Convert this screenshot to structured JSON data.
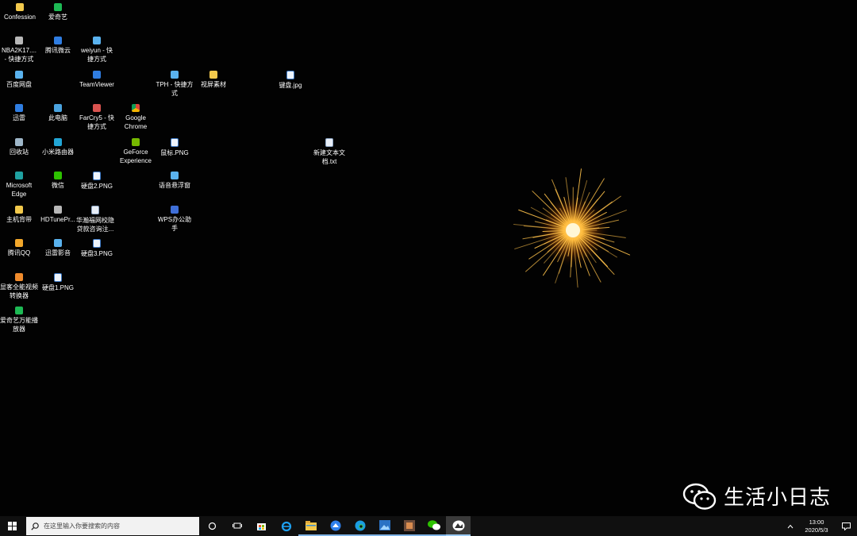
{
  "desktop": {
    "icons": [
      {
        "label": "Confession",
        "icon": "folder-icon"
      },
      {
        "label": "爱奇艺",
        "icon": "iqiyi-icon"
      },
      {
        "label": "NBA2K17....\n- 快捷方式",
        "icon": "shortcut-icon"
      },
      {
        "label": "腾讯微云",
        "icon": "weiyun-icon"
      },
      {
        "label": "weiyun - 快\n捷方式",
        "icon": "weiyun-shortcut-icon"
      },
      {
        "label": "百度网盘",
        "icon": "baidu-netdisk-icon"
      },
      {
        "label": "TeamViewer",
        "icon": "teamviewer-icon"
      },
      {
        "label": "TPH - 快捷方\n式",
        "icon": "image-shortcut-icon"
      },
      {
        "label": "视屏素材",
        "icon": "folder-icon"
      },
      {
        "label": "键盘.jpg",
        "icon": "image-file-icon"
      },
      {
        "label": "迅雷",
        "icon": "xunlei-icon"
      },
      {
        "label": "此电脑",
        "icon": "this-pc-icon"
      },
      {
        "label": "FarCry5 - 快\n捷方式",
        "icon": "game-shortcut-icon"
      },
      {
        "label": "Google\nChrome",
        "icon": "chrome-icon"
      },
      {
        "label": "回收站",
        "icon": "recycle-bin-icon"
      },
      {
        "label": "小米路由器",
        "icon": "router-icon"
      },
      {
        "label": "GeForce\nExperience",
        "icon": "nvidia-icon"
      },
      {
        "label": "鼠标.PNG",
        "icon": "png-file-icon"
      },
      {
        "label": "新建文本文\n档.txt",
        "icon": "text-file-icon"
      },
      {
        "label": "Microsoft\nEdge",
        "icon": "edge-icon"
      },
      {
        "label": "微信",
        "icon": "wechat-icon"
      },
      {
        "label": "硬盘2.PNG",
        "icon": "png-file-icon"
      },
      {
        "label": "语音悬浮窗",
        "icon": "voice-icon"
      },
      {
        "label": "主机背带",
        "icon": "folder-icon"
      },
      {
        "label": "HDTunePr...",
        "icon": "hdtune-icon"
      },
      {
        "label": "华瀚福网校隐\n贷款咨询注...",
        "icon": "document-icon"
      },
      {
        "label": "WPS办公助\n手",
        "icon": "wps-icon"
      },
      {
        "label": "腾讯QQ",
        "icon": "qq-icon"
      },
      {
        "label": "迅雷影音",
        "icon": "xunlei-player-icon"
      },
      {
        "label": "硬盘3.PNG",
        "icon": "png-file-icon"
      },
      {
        "label": "显客全能视频\n转换器",
        "icon": "video-converter-icon"
      },
      {
        "label": "硬盘1.PNG",
        "icon": "png-file-icon"
      },
      {
        "label": "爱奇艺万能播\n放器",
        "icon": "iqiyi-player-icon"
      }
    ]
  },
  "watermark": {
    "text": "生活小日志",
    "icon": "wechat-logo-icon"
  },
  "taskbar": {
    "search_placeholder": "在这里输入你要搜索的内容",
    "apps": [
      "cortana-icon",
      "task-view-icon",
      "store-icon",
      "ie-icon",
      "file-explorer-icon",
      "browser-icon",
      "edge-icon",
      "photos-icon",
      "game-icon",
      "wechat-icon",
      "screenshot-app-icon"
    ],
    "clock_time": "13:00",
    "clock_date": "2020/5/3"
  },
  "colors": {
    "taskbar_bg": "#101010",
    "desktop_bg": "#020202",
    "accent": "#9ccbf5"
  }
}
